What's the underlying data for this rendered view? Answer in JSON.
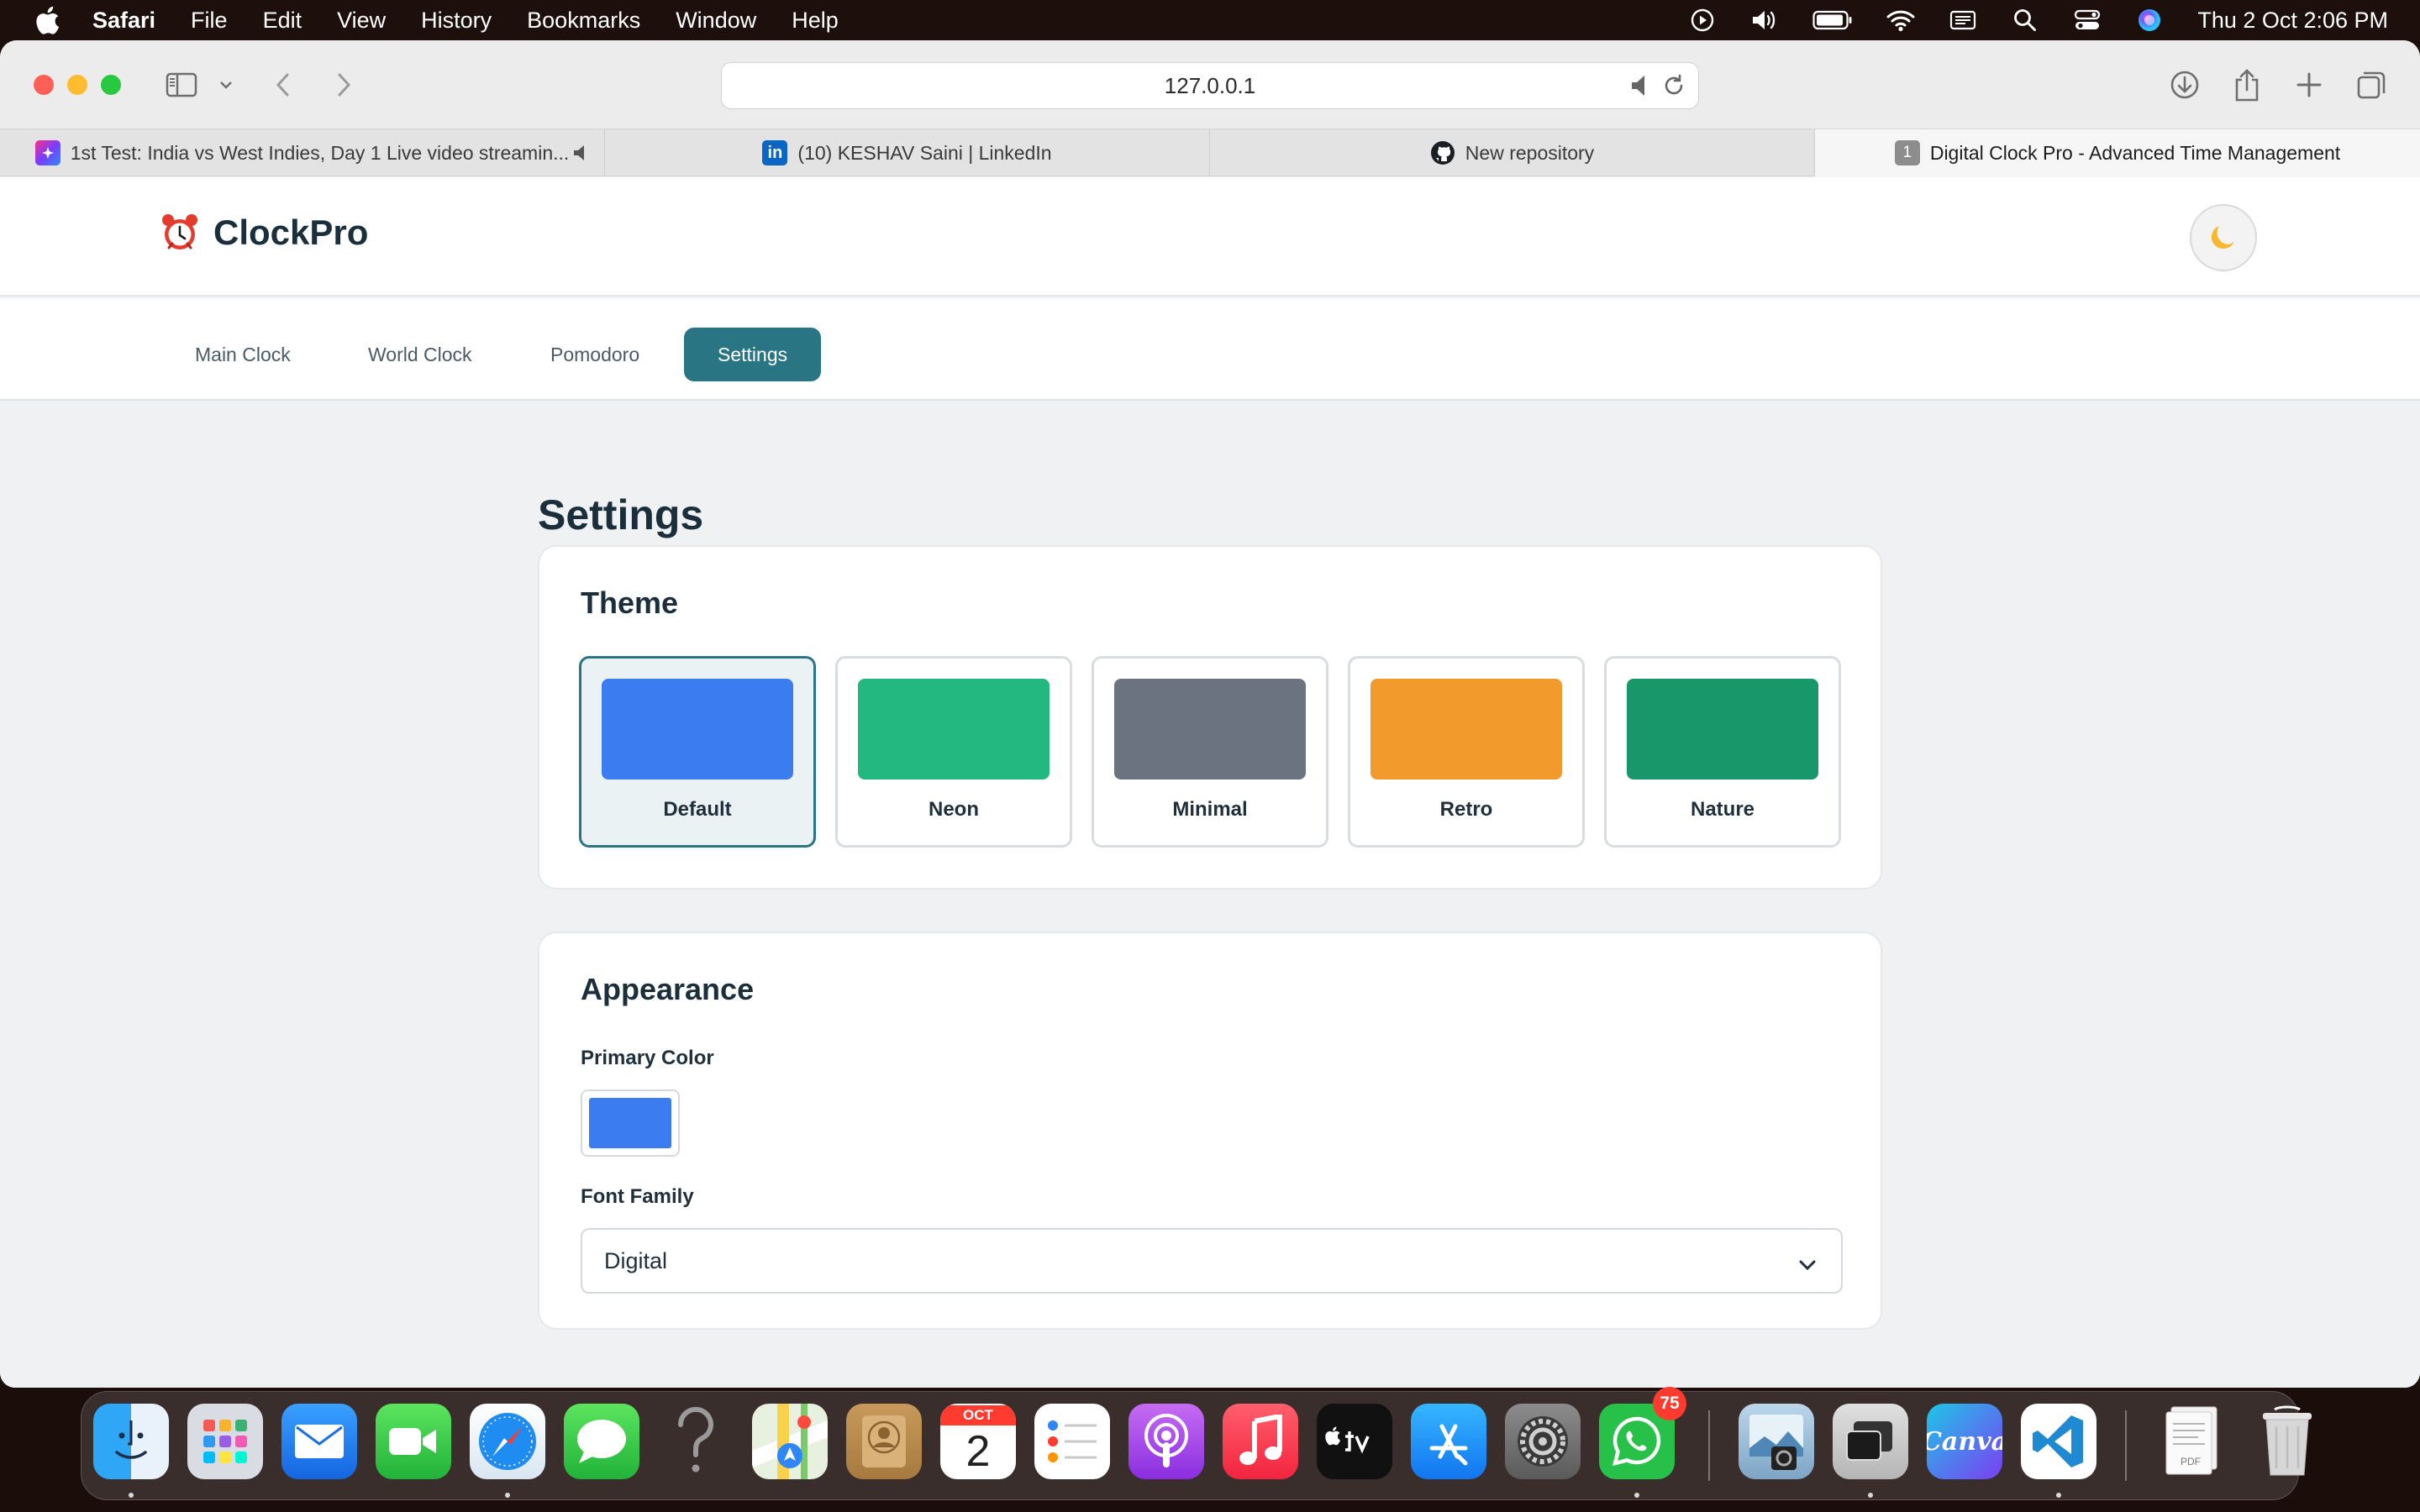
{
  "menubar": {
    "app_name": "Safari",
    "items": [
      "File",
      "Edit",
      "View",
      "History",
      "Bookmarks",
      "Window",
      "Help"
    ],
    "clock": "Thu 2 Oct  2:06 PM"
  },
  "browser": {
    "url": "127.0.0.1",
    "tabs": [
      {
        "title": "1st Test: India vs West Indies, Day 1 Live video streamin..."
      },
      {
        "title": "(10) KESHAV Saini | LinkedIn"
      },
      {
        "title": "New repository"
      },
      {
        "title": "Digital Clock Pro - Advanced Time Management",
        "favicon_text": "1"
      }
    ]
  },
  "app": {
    "logo_text": "ClockPro",
    "logo_icon": "alarm-clock-icon",
    "theme_toggle_icon": "moon-icon",
    "nav": [
      "Main Clock",
      "World Clock",
      "Pomodoro",
      "Settings"
    ],
    "active_nav": "Settings"
  },
  "settings": {
    "title": "Settings",
    "theme": {
      "heading": "Theme",
      "options": [
        {
          "label": "Default",
          "color": "#3b7cf0",
          "selected": true
        },
        {
          "label": "Neon",
          "color": "#22b87f",
          "selected": false
        },
        {
          "label": "Minimal",
          "color": "#6b7280",
          "selected": false
        },
        {
          "label": "Retro",
          "color": "#f29b2c",
          "selected": false
        },
        {
          "label": "Nature",
          "color": "#17976a",
          "selected": false
        }
      ]
    },
    "appearance": {
      "heading": "Appearance",
      "primary_color_label": "Primary Color",
      "primary_color": "#3b7cf0",
      "font_family_label": "Font Family",
      "font_family_value": "Digital"
    }
  },
  "dock": {
    "calendar": {
      "month": "OCT",
      "day": "2"
    },
    "whatsapp_badge": "75",
    "canva_label": "Canva",
    "pdf_label": "PDF"
  },
  "colors": {
    "accent": "#2a7584",
    "heading": "#1b2e3c",
    "page_bg": "#eff1f3"
  }
}
